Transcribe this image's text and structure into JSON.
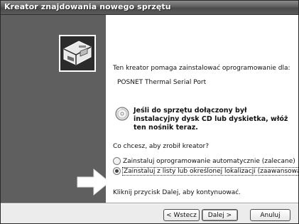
{
  "window": {
    "title": "Kreator znajdowania nowego sprzętu"
  },
  "content": {
    "intro": "Ten kreator pomaga zainstalować oprogramowanie dla:",
    "device_name": "POSNET Thermal Serial Port",
    "cd_hint": "Jeśli do sprzętu dołączony był instalacyjny dysk CD lub dyskietka, włóż ten nośnik teraz.",
    "question": "Co chcesz, aby zrobił kreator?",
    "options": [
      {
        "label": "Zainstaluj oprogramowanie automatycznie (zalecane)",
        "selected": false
      },
      {
        "label": "Zainstaluj z listy lub określonej lokalizacji (zaawansowane)",
        "selected": true
      }
    ],
    "footer_note": "Kliknij przycisk Dalej, aby kontynuować."
  },
  "buttons": {
    "back": "< Wstecz",
    "next": "Dalej >",
    "cancel": "Anuluj"
  },
  "icons": {
    "wizard": "hardware-wizard-icon",
    "cd": "cd-disc-icon",
    "arrow": "arrow-right-icon"
  }
}
